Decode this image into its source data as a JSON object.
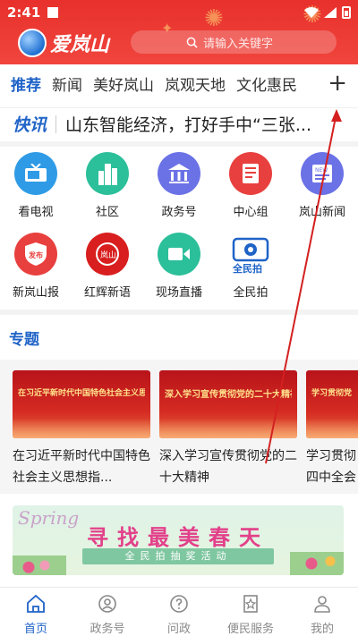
{
  "status_bar": {
    "time": "2:41"
  },
  "app": {
    "name": "爱岚山"
  },
  "search": {
    "placeholder": "请输入关键字"
  },
  "tabs": [
    {
      "label": "推荐",
      "active": true
    },
    {
      "label": "新闻"
    },
    {
      "label": "美好岚山"
    },
    {
      "label": "岚观天地"
    },
    {
      "label": "文化惠民"
    }
  ],
  "ticker": {
    "tag": "快讯",
    "text": "山东智能经济，打好手中“三张..."
  },
  "grid": [
    {
      "label": "看电视",
      "color": "#2f9be6",
      "icon": "tv-icon"
    },
    {
      "label": "社区",
      "color": "#2bbf9a",
      "icon": "building-icon"
    },
    {
      "label": "政务号",
      "color": "#6b72e6",
      "icon": "government-icon"
    },
    {
      "label": "中心组",
      "color": "#e8403e",
      "icon": "document-icon"
    },
    {
      "label": "岚山新闻",
      "color": "#6b72e6",
      "icon": "newspaper-icon"
    },
    {
      "label": "新岚山报",
      "color": "#e8403e",
      "icon": "shield-icon"
    },
    {
      "label": "红辉新语",
      "color": "#d81e1e",
      "icon": "red-logo-icon"
    },
    {
      "label": "现场直播",
      "color": "#2bbf9a",
      "icon": "video-icon"
    },
    {
      "label": "全民拍",
      "color": "#1f63c7",
      "icon": "camera-icon"
    }
  ],
  "grid_icon_text": {
    "publish": "发布",
    "lanshan": "岚山",
    "quanminpai": "全民拍"
  },
  "section": {
    "title": "专题"
  },
  "cards": [
    {
      "banner": "在习近平新时代中国特色社会主义思想指引下",
      "title": "在习近平新时代中国特色社会主义思想指..."
    },
    {
      "banner": "深入学习宣传贯彻党的二十大精神",
      "title": "深入学习宣传贯彻党的二十大精神"
    },
    {
      "banner": "学习贯彻党",
      "title": "学习贯彻四中全会"
    }
  ],
  "promo": {
    "en": "Spring",
    "headline": "寻找最美春天",
    "sub": "全民拍抽奖活动"
  },
  "bottom_nav": [
    {
      "label": "首页",
      "active": true,
      "icon": "home-icon"
    },
    {
      "label": "政务号",
      "icon": "government-icon"
    },
    {
      "label": "问政",
      "icon": "question-icon"
    },
    {
      "label": "便民服务",
      "icon": "star-bookmark-icon"
    },
    {
      "label": "我的",
      "icon": "user-icon"
    }
  ]
}
